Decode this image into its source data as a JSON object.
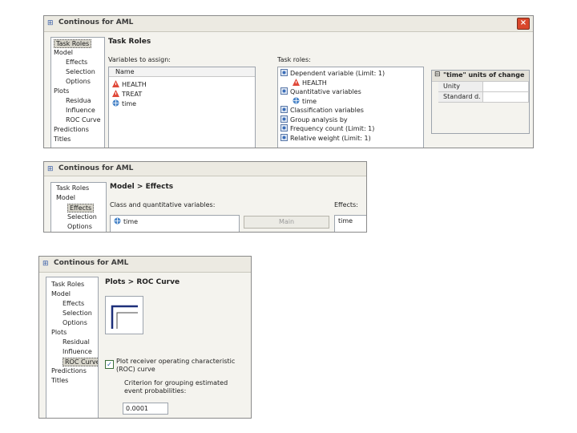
{
  "window_title": "Continous for AML",
  "w1": {
    "nav": [
      "Task Roles",
      "Model",
      "Effects",
      "Selection",
      "Options",
      "Plots",
      "Residua",
      "Influence",
      "ROC Curve",
      "Predictions",
      "Titles"
    ],
    "section_title": "Task Roles",
    "variables_label": "Variables to assign:",
    "list_header": "Name",
    "variables": [
      "HEALTH",
      "TREAT",
      "time"
    ],
    "roles_label": "Task roles:",
    "roles": [
      {
        "label": "Dependent variable (Limit: 1)",
        "indent": false
      },
      {
        "label": "HEALTH",
        "indent": true
      },
      {
        "label": "Quantitative variables",
        "indent": false
      },
      {
        "label": "time",
        "indent": true
      },
      {
        "label": "Classification variables",
        "indent": false
      },
      {
        "label": "Group analysis by",
        "indent": false
      },
      {
        "label": "Frequency count (Limit: 1)",
        "indent": false
      },
      {
        "label": "Relative weight (Limit: 1)",
        "indent": false
      }
    ],
    "prop_title": "\"time\" units of change",
    "prop_rows": [
      {
        "key": "Unity",
        "value": ""
      },
      {
        "key": "Standard d.",
        "value": ""
      }
    ]
  },
  "w2": {
    "nav": [
      "Task Roles",
      "Model",
      "Effects",
      "Selection",
      "Options"
    ],
    "section_title": "Model > Effects",
    "vars_label": "Class and quantitative variables:",
    "vars": [
      "time"
    ],
    "main_button": "Main",
    "effects_label": "Effects:",
    "effects": [
      "time"
    ]
  },
  "w3": {
    "nav": [
      "Task Roles",
      "Model",
      "Effects",
      "Selection",
      "Options",
      "Plots",
      "Residual",
      "Influence",
      "ROC Curve",
      "Predictions",
      "Titles"
    ],
    "section_title": "Plots > ROC Curve",
    "checkbox_label": "Plot receiver operating characteristic (ROC) curve",
    "checkbox_checked": true,
    "criterion_label": "Criterion for grouping estimated event probabilities:",
    "criterion_value": "0.0001"
  },
  "colors": {
    "accent": "#3a5fa8",
    "close": "#d9472b",
    "selected": "#d7d5cb"
  },
  "icons": {
    "var_categorical": "warning-triangle-icon",
    "var_numeric": "globe-icon",
    "role": "role-node-icon",
    "window": "window-icon",
    "close": "close-x-icon"
  }
}
